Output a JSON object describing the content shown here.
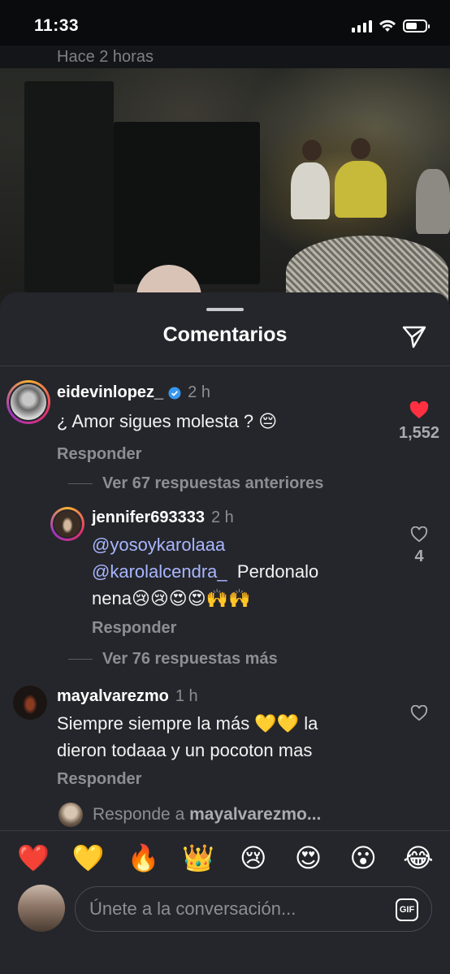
{
  "status_bar": {
    "time": "11:33"
  },
  "post": {
    "time_ago": "Hace 2 horas"
  },
  "sheet": {
    "title": "Comentarios"
  },
  "comments": [
    {
      "username": "eidevinlopez_",
      "verified": true,
      "time": "2 h",
      "text": "¿ Amor sigues molesta ? 😔",
      "reply_label": "Responder",
      "likes": "1,552",
      "liked": true,
      "view_replies": "Ver 67 respuestas anteriores"
    },
    {
      "username": "jennifer693333",
      "time": "2 h",
      "mention1": "@yosoykarolaaa",
      "mention2": "@karolalcendra_",
      "text_after_mention": "Perdonalo",
      "text_line3": "nena😢😢😍😍🙌🙌",
      "reply_label": "Responder",
      "likes": "4",
      "view_replies": "Ver 76 respuestas más"
    },
    {
      "username": "mayalvarezmo",
      "time": "1 h",
      "text_line1": "Siempre siempre la más 💛💛 la",
      "text_line2": "dieron todaaa y un pocoton mas",
      "reply_label": "Responder"
    }
  ],
  "reply_prompt": {
    "prefix": "Responde a",
    "target": "mayalvarezmo..."
  },
  "emoji_bar": [
    "❤️",
    "💛",
    "🔥",
    "👑",
    "😢",
    "😍",
    "😮",
    "😂"
  ],
  "composer": {
    "placeholder": "Únete a la conversación...",
    "gif_label": "GIF"
  },
  "colors": {
    "sheet_bg": "#25262b",
    "like_red": "#ff3040",
    "mention": "#a8b6ff",
    "muted": "#8c8e94"
  }
}
